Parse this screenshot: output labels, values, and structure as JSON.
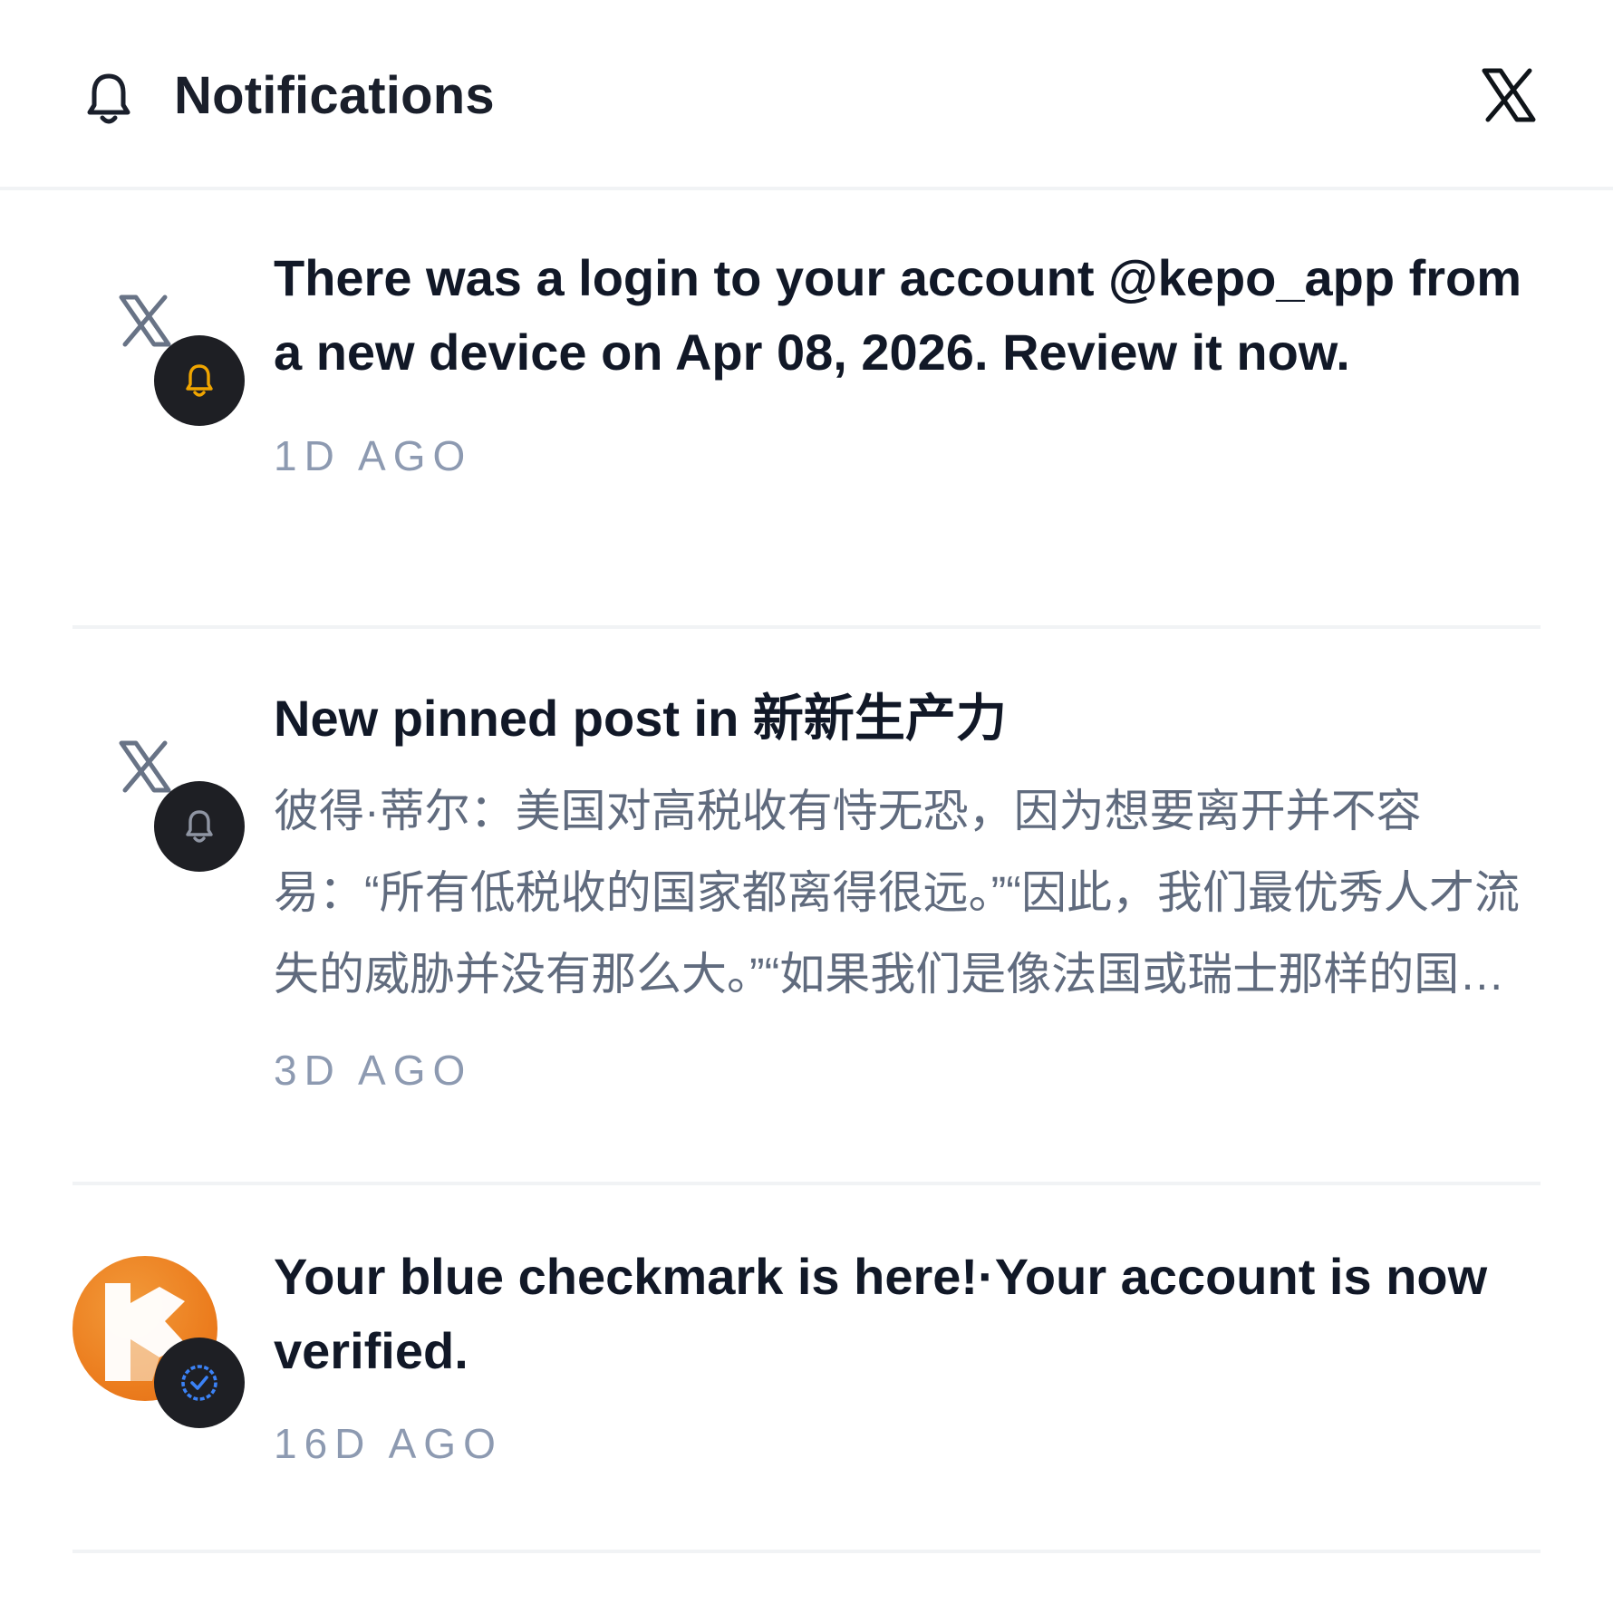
{
  "header": {
    "title": "Notifications",
    "bell_icon": "bell-icon",
    "close_icon": "x-logo-icon"
  },
  "notifications": [
    {
      "avatar_icon": "x-logo-icon",
      "badge_icon": "bell-icon",
      "badge_color": "#f0a500",
      "title": "There was a login to your account @kepo_app from a new device on Apr 08, 2026. Review it now.",
      "body": "",
      "time": "1D AGO"
    },
    {
      "avatar_icon": "x-logo-icon",
      "badge_icon": "bell-icon",
      "badge_color": "#8f95a3",
      "title": "New pinned post in 新新生产力",
      "body": "彼得·蒂尔：美国对高税收有恃无恐，因为想要离开并不容易：“所有低税收的国家都离得很远。”“因此，我们最优秀人才流失的威胁并没有那么大。”“如果我们是像法国或瑞士那样的国家……",
      "time": "3D AGO"
    },
    {
      "avatar_icon": "kepo-logo-icon",
      "badge_icon": "verified-badge-icon",
      "badge_color": "#3b82f6",
      "title": "Your blue checkmark is here!·Your account is now verified.",
      "body": "",
      "time": "16D AGO"
    }
  ]
}
